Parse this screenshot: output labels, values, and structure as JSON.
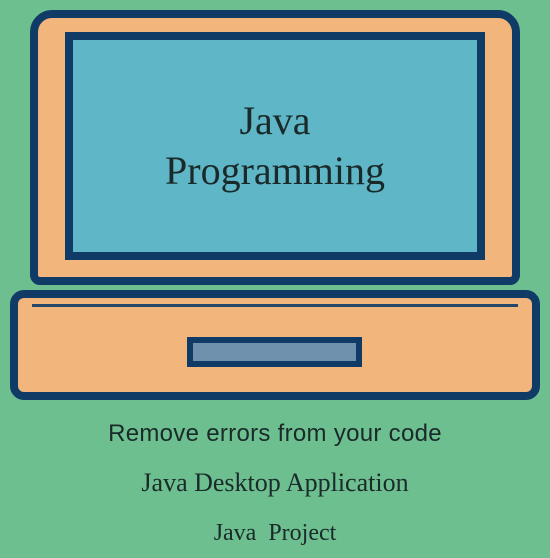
{
  "screen": {
    "line1": "Java",
    "line2": "Programming"
  },
  "captions": {
    "line1": "Remove errors from your code",
    "line2": "Java Desktop Application",
    "line3": "Java Project"
  }
}
